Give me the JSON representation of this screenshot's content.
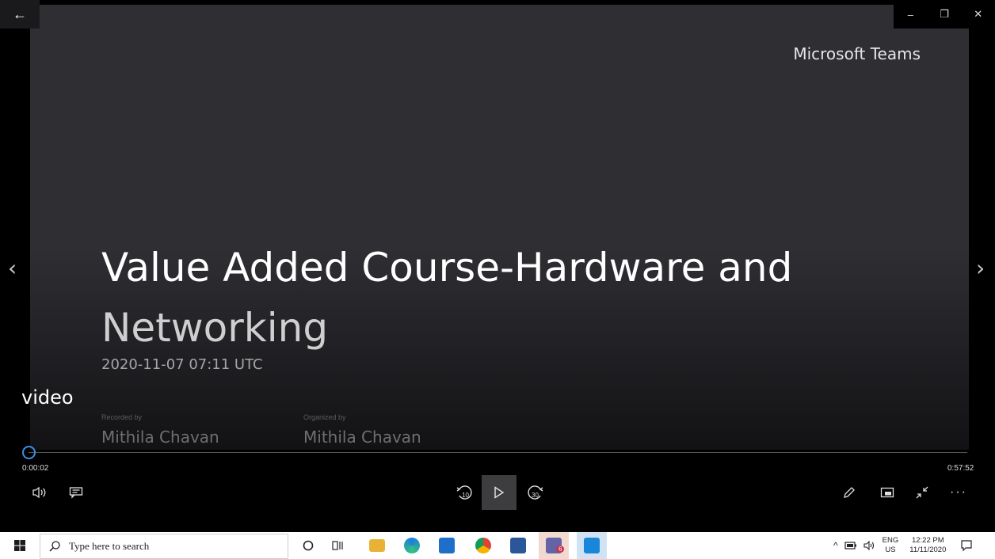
{
  "window": {
    "back_icon": "back-arrow-icon",
    "controls": {
      "minimize": "–",
      "restore": "❐",
      "close": "✕"
    }
  },
  "slide": {
    "brand": "Microsoft Teams",
    "title_line1": "Value Added Course-Hardware and",
    "title_line2": "Networking",
    "timestamp": "2020-11-07 07:11 UTC",
    "recorded_by_label": "Recorded by",
    "recorded_by": "Mithila Chavan",
    "organized_by_label": "Organized by",
    "organized_by": "Mithila Chavan"
  },
  "overlay": {
    "video_label": "video"
  },
  "player": {
    "current_time": "0:00:02",
    "duration": "0:57:52",
    "progress_fraction": 0.0006,
    "skip_back_seconds": "10",
    "skip_forward_seconds": "30",
    "accent_color": "#3a8ee6"
  },
  "taskbar": {
    "search_placeholder": "Type here to search",
    "language_top": "ENG",
    "language_bottom": "US",
    "time": "12:22 PM",
    "date": "11/11/2020",
    "teams_badge": "6"
  }
}
